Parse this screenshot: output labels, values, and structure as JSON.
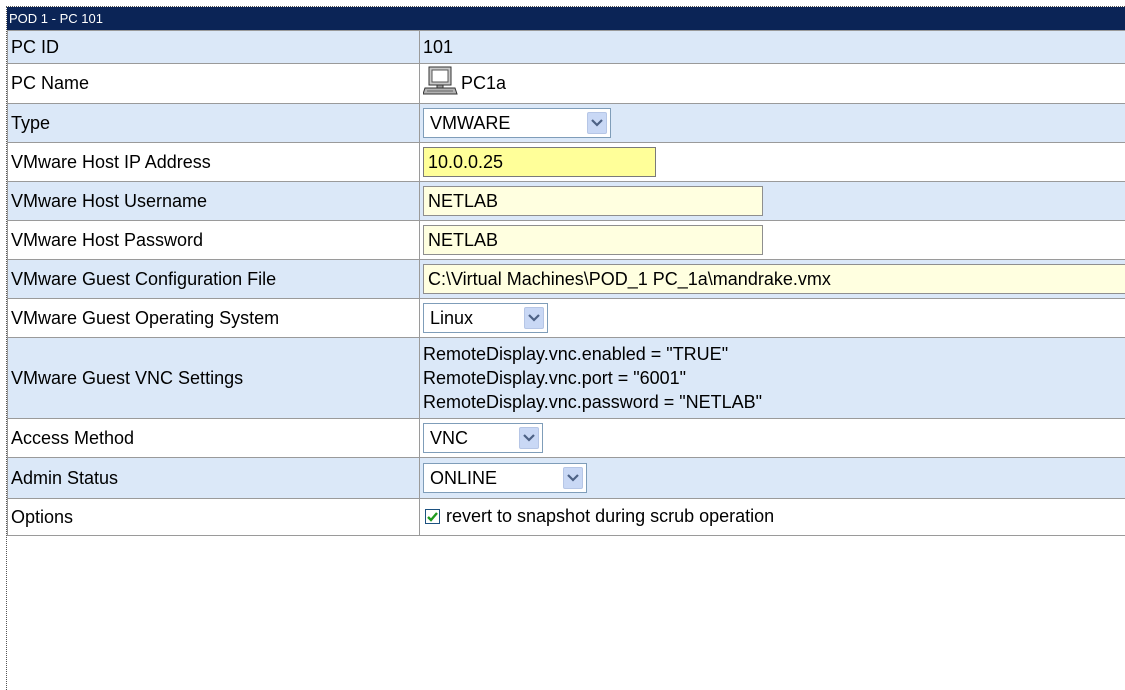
{
  "header": {
    "title": "POD 1 - PC 101"
  },
  "rows": {
    "pc_id": {
      "label": "PC ID",
      "value": "101"
    },
    "pc_name": {
      "label": "PC Name",
      "value": "PC1a",
      "icon": "computer-icon"
    },
    "type": {
      "label": "Type",
      "selected": "VMWARE"
    },
    "host_ip": {
      "label": "VMware Host IP Address",
      "value": "10.0.0.25"
    },
    "host_username": {
      "label": "VMware Host Username",
      "value": "NETLAB"
    },
    "host_password": {
      "label": "VMware Host Password",
      "value": "NETLAB"
    },
    "guest_config": {
      "label": "VMware Guest Configuration File",
      "value": "C:\\Virtual Machines\\POD_1 PC_1a\\mandrake.vmx"
    },
    "guest_os": {
      "label": "VMware Guest Operating System",
      "selected": "Linux"
    },
    "guest_vnc": {
      "label": "VMware Guest VNC Settings",
      "lines": [
        "RemoteDisplay.vnc.enabled = \"TRUE\"",
        "RemoteDisplay.vnc.port = \"6001\"",
        "RemoteDisplay.vnc.password = \"NETLAB\""
      ]
    },
    "access_method": {
      "label": "Access Method",
      "selected": "VNC"
    },
    "admin_status": {
      "label": "Admin Status",
      "selected": "ONLINE"
    },
    "options": {
      "label": "Options",
      "checkbox_label": "revert to snapshot during scrub operation",
      "checked": true
    }
  },
  "colors": {
    "header_bg": "#0b2456",
    "row_blue": "#dbe8f8",
    "field_bg": "#ffffe0",
    "field_highlight": "#ffff99",
    "checkbox_check": "#1f9a1f"
  }
}
